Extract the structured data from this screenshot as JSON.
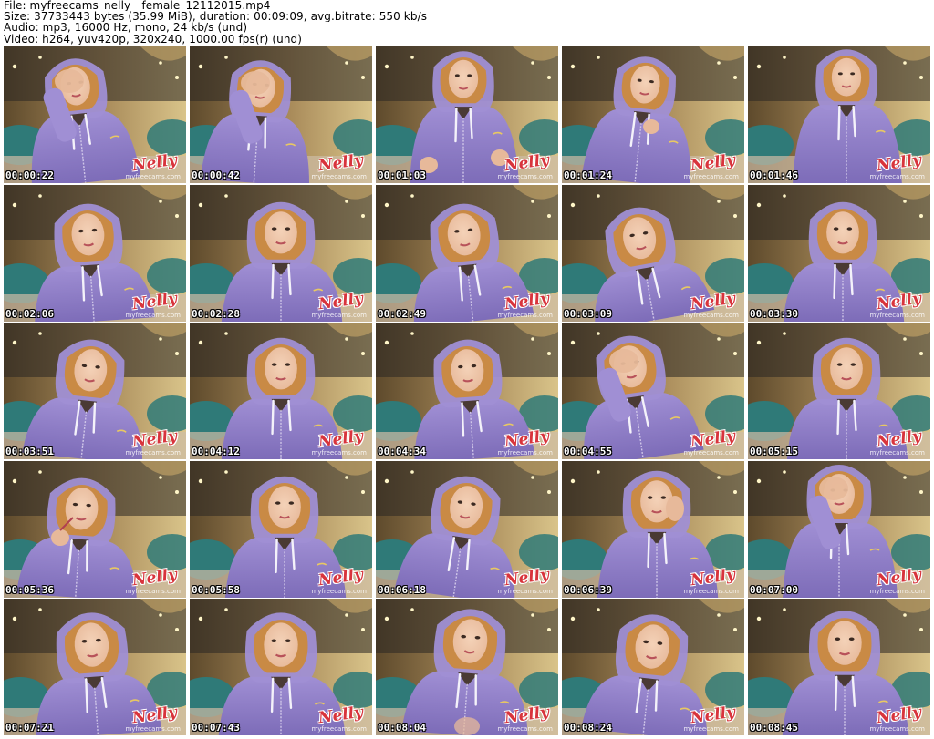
{
  "header": {
    "file_line": "File: myfreecams_nelly__female_12112015.mp4",
    "size_line": "Size: 37733443 bytes (35.99 MiB), duration: 00:09:09, avg.bitrate: 550 kb/s",
    "audio_line": "Audio: mp3, 16000 Hz, mono, 24 kb/s (und)",
    "video_line": "Video: h264, yuv420p, 320x240, 1000.00 fps(r) (und)"
  },
  "watermark": {
    "name": "Nelly",
    "site": "myfreecams.com"
  },
  "colors": {
    "hoodie": "#a08fd4",
    "hoodie_shadow": "#7d6cb8",
    "wall_light": "#d9c48a",
    "wall_dark": "#5e4a2c",
    "headboard": "#2a2622",
    "pillow": "#2f7a78",
    "skin": "#e7b99a",
    "hair": "#c98a45",
    "watermark_red": "#d8343c"
  },
  "thumbnails": [
    {
      "timestamp": "00:00:22"
    },
    {
      "timestamp": "00:00:42"
    },
    {
      "timestamp": "00:01:03"
    },
    {
      "timestamp": "00:01:24"
    },
    {
      "timestamp": "00:01:46"
    },
    {
      "timestamp": "00:02:06"
    },
    {
      "timestamp": "00:02:28"
    },
    {
      "timestamp": "00:02:49"
    },
    {
      "timestamp": "00:03:09"
    },
    {
      "timestamp": "00:03:30"
    },
    {
      "timestamp": "00:03:51"
    },
    {
      "timestamp": "00:04:12"
    },
    {
      "timestamp": "00:04:34"
    },
    {
      "timestamp": "00:04:55"
    },
    {
      "timestamp": "00:05:15"
    },
    {
      "timestamp": "00:05:36"
    },
    {
      "timestamp": "00:05:58"
    },
    {
      "timestamp": "00:06:18"
    },
    {
      "timestamp": "00:06:39"
    },
    {
      "timestamp": "00:07:00"
    },
    {
      "timestamp": "00:07:21"
    },
    {
      "timestamp": "00:07:43"
    },
    {
      "timestamp": "00:08:04"
    },
    {
      "timestamp": "00:08:24"
    },
    {
      "timestamp": "00:08:45"
    }
  ]
}
